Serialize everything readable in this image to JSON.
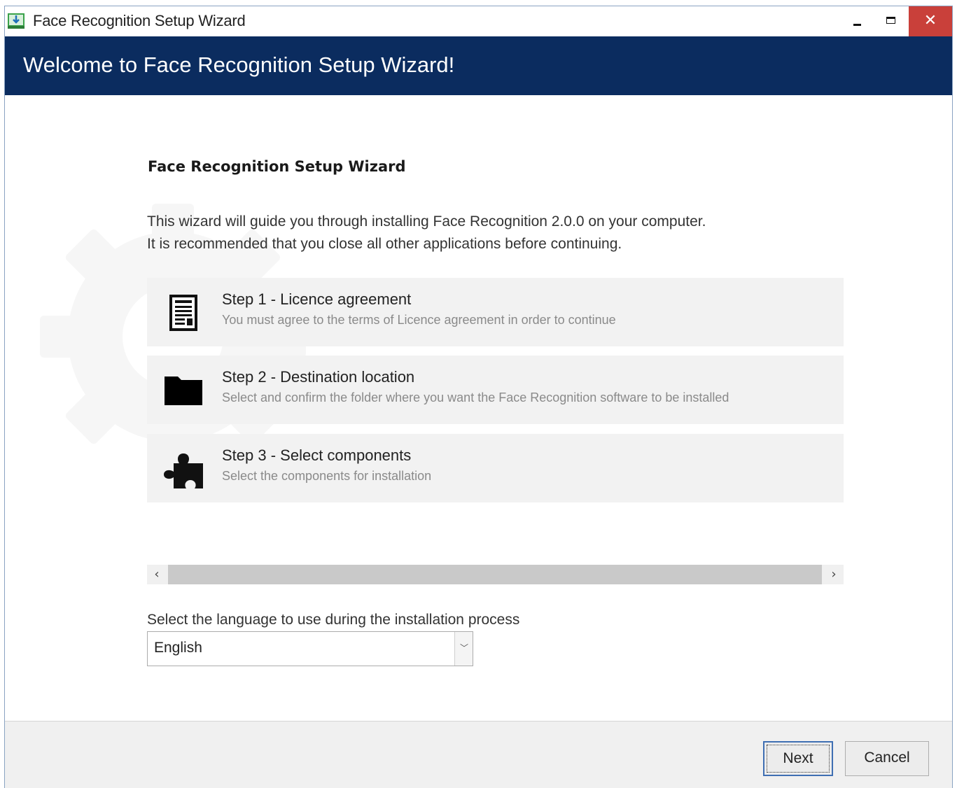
{
  "window": {
    "title": "Face Recognition Setup Wizard",
    "controls": {
      "minimize": "minimize",
      "maximize": "maximize",
      "close": "✕"
    }
  },
  "header": {
    "title": "Welcome to Face Recognition Setup Wizard!"
  },
  "content": {
    "title": "Face Recognition Setup Wizard",
    "intro_line1": "This wizard will guide you through installing Face Recognition 2.0.0 on your computer.",
    "intro_line2": "It is recommended that you close all other applications before continuing."
  },
  "steps": [
    {
      "icon": "document-icon",
      "title": "Step 1 - Licence agreement",
      "description": "You must agree to the terms of Licence agreement in order to continue"
    },
    {
      "icon": "folder-icon",
      "title": "Step 2 - Destination location",
      "description": "Select and confirm the folder where you want the Face Recognition software to be installed"
    },
    {
      "icon": "puzzle-icon",
      "title": "Step 3 - Select components",
      "description": "Select the components for installation"
    }
  ],
  "scrollbar": {
    "left_arrow": "‹",
    "right_arrow": "›"
  },
  "language": {
    "label": "Select the language to use during the installation process",
    "selected": "English"
  },
  "footer": {
    "next_label": "Next",
    "cancel_label": "Cancel"
  },
  "colors": {
    "header_bg": "#0b2c5f",
    "close_button": "#c9403a",
    "step_bg": "#f2f2f2"
  }
}
